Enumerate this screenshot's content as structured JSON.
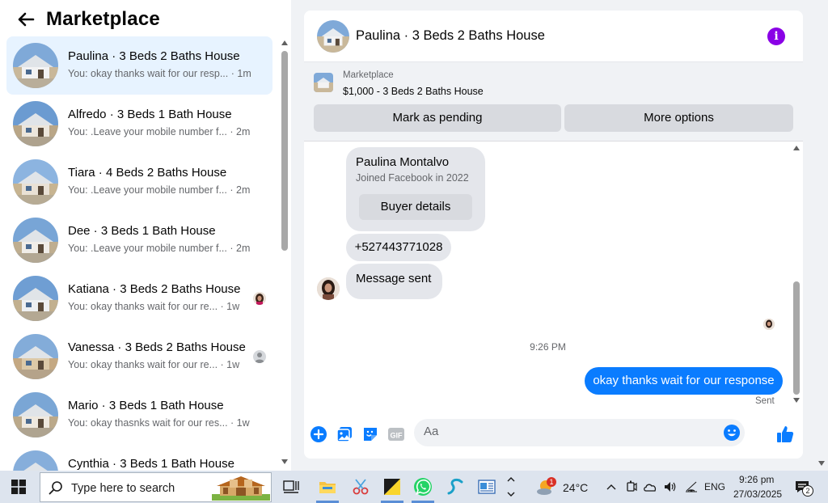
{
  "sidebar": {
    "title": "Marketplace",
    "conversations": [
      {
        "name": "Paulina · 3 Beds 2 Baths House",
        "preview": "You: okay thanks wait for our resp...",
        "time": "· 1m",
        "active": true
      },
      {
        "name": "Alfredo · 3 Beds 1 Bath House",
        "preview": "You: .Leave your mobile number f...",
        "time": "· 2m",
        "active": false
      },
      {
        "name": "Tiara · 4 Beds 2 Baths House",
        "preview": "You: .Leave your mobile number f...",
        "time": "· 2m",
        "active": false
      },
      {
        "name": "Dee · 3 Beds 1 Bath House",
        "preview": "You: .Leave your mobile number f...",
        "time": "· 2m",
        "active": false
      },
      {
        "name": "Katiana · 3 Beds 2 Baths House",
        "preview": "You: okay thanks wait for our re...",
        "time": "· 1w",
        "active": false
      },
      {
        "name": "Vanessa · 3 Beds 2 Baths House",
        "preview": "You: okay thanks wait for our re...",
        "time": "· 1w",
        "active": false
      },
      {
        "name": "Mario · 3 Beds 1 Bath House",
        "preview": "You: okay thasnks wait for our res...",
        "time": "· 1w",
        "active": false
      },
      {
        "name": "Cynthia · 3 Beds 1 Bath House",
        "preview": "",
        "time": "",
        "active": false
      }
    ]
  },
  "chat": {
    "title": "Paulina · 3 Beds 2 Baths House",
    "listing": {
      "category": "Marketplace",
      "price_title": "$1,000 - 3 Beds 2 Baths House",
      "mark_pending": "Mark as pending",
      "more_options": "More options"
    },
    "buyer_card": {
      "name": "Paulina Montalvo",
      "joined": "Joined Facebook in 2022",
      "button": "Buyer details"
    },
    "phone_message": "+527443771028",
    "message_sent": "Message sent",
    "timestamp": "9:26 PM",
    "outgoing": "okay thanks wait for our response",
    "status": "Sent",
    "composer_placeholder": "Aa"
  },
  "taskbar": {
    "search_placeholder": "Type here to search",
    "weather_temp": "24°C",
    "weather_badge": "1",
    "language": "ENG",
    "time": "9:26 pm",
    "date": "27/03/2025",
    "notification_count": "2"
  },
  "colors": {
    "messenger_blue": "#0a7cff",
    "info_purple": "#8a00e6",
    "active_row": "#e7f3ff"
  }
}
